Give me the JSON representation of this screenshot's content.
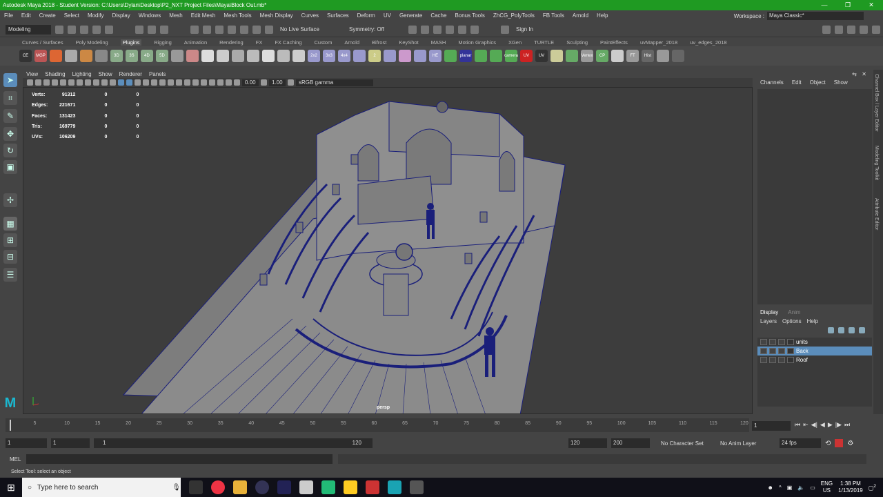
{
  "title": "Autodesk Maya 2018 - Student Version: C:\\Users\\Dylan\\Desktop\\P2_NXT Project Files\\Maya\\Block Out.mb*",
  "window_controls": [
    "—",
    "❐",
    "✕"
  ],
  "menus": [
    "File",
    "Edit",
    "Create",
    "Select",
    "Modify",
    "Display",
    "Windows",
    "Mesh",
    "Edit Mesh",
    "Mesh Tools",
    "Mesh Display",
    "Curves",
    "Surfaces",
    "Deform",
    "UV",
    "Generate",
    "Cache",
    "Bonus Tools",
    "ZhCG_PolyTools",
    "FB Tools",
    "Arnold",
    "Help"
  ],
  "workspace": {
    "label": "Workspace :",
    "value": "Maya Classic*"
  },
  "status": {
    "mode": "Modeling",
    "live_surface": "No Live Surface",
    "symmetry": "Symmetry: Off",
    "sign_in": "Sign In"
  },
  "shelf_tabs": [
    "Curves / Surfaces",
    "Poly Modeling",
    "Plugins",
    "Rigging",
    "Animation",
    "Rendering",
    "FX",
    "FX Caching",
    "Custom",
    "Arnold",
    "Bifrost",
    "KeyShot",
    "MASH",
    "Motion Graphics",
    "XGen",
    "TURTLE",
    "Sculpting",
    "PaintEffects",
    "uvMapper_2018",
    "uv_edges_2018"
  ],
  "active_shelf": "Plugins",
  "shelf_icons": [
    "CE",
    "MGP",
    "",
    "",
    "",
    "",
    "3D",
    "3S",
    "4D",
    "5D",
    "",
    "",
    "",
    "",
    "",
    "",
    "",
    "",
    "",
    "2x2",
    "3x3",
    "4x4",
    "",
    "2",
    "",
    "",
    "",
    "HE",
    "",
    "planar",
    "",
    "",
    "camera",
    "UV",
    "UV",
    "",
    "",
    "Vertex",
    "CP",
    "",
    "FT",
    "Hist",
    "",
    ""
  ],
  "panel_menu": [
    "View",
    "Shading",
    "Lighting",
    "Show",
    "Renderer",
    "Panels"
  ],
  "viewport": {
    "exposure": "0.00",
    "gamma": "1.00",
    "colorspace": "sRGB gamma",
    "camera": "persp"
  },
  "hud": [
    {
      "label": "Verts:",
      "v": "91312",
      "a": "0",
      "b": "0"
    },
    {
      "label": "Edges:",
      "v": "221671",
      "a": "0",
      "b": "0"
    },
    {
      "label": "Faces:",
      "v": "131423",
      "a": "0",
      "b": "0"
    },
    {
      "label": "Tris:",
      "v": "169779",
      "a": "0",
      "b": "0"
    },
    {
      "label": "UVs:",
      "v": "106209",
      "a": "0",
      "b": "0"
    }
  ],
  "channel_box": {
    "menu": [
      "Channels",
      "Edit",
      "Object",
      "Show"
    ]
  },
  "side_tabs": [
    "Channel Box / Layer Editor",
    "Modeling Toolkit",
    "Attribute Editor"
  ],
  "layer_editor": {
    "tabs": [
      "Display",
      "Anim"
    ],
    "menu": [
      "Layers",
      "Options",
      "Help"
    ],
    "layers": [
      {
        "name": "units",
        "selected": false
      },
      {
        "name": "Back",
        "selected": true
      },
      {
        "name": "Roof",
        "selected": false
      }
    ]
  },
  "timeline": {
    "ticks": [
      "5",
      "10",
      "15",
      "20",
      "25",
      "30",
      "35",
      "40",
      "45",
      "50",
      "55",
      "60",
      "65",
      "70",
      "75",
      "80",
      "85",
      "90",
      "95",
      "100",
      "105",
      "110",
      "115",
      "120"
    ],
    "tick_values": [
      5,
      10,
      15,
      20,
      25,
      30,
      35,
      40,
      45,
      50,
      55,
      60,
      65,
      70,
      75,
      80,
      85,
      90,
      95,
      100,
      105,
      110,
      115,
      120
    ],
    "current_frame": "1"
  },
  "range": {
    "start": "1",
    "start2": "1",
    "slider_start": "1",
    "slider_end": "120",
    "end": "120",
    "end2": "200",
    "character_set": "No Character Set",
    "anim_layer": "No Anim Layer",
    "fps": "24 fps"
  },
  "cmd": {
    "label": "MEL"
  },
  "help_line": "Select Tool: select an object",
  "taskbar": {
    "search_placeholder": "Type here to search",
    "lang1": "ENG",
    "lang2": "US",
    "time": "1:38 PM",
    "date": "1/13/2019",
    "notif": "2"
  }
}
